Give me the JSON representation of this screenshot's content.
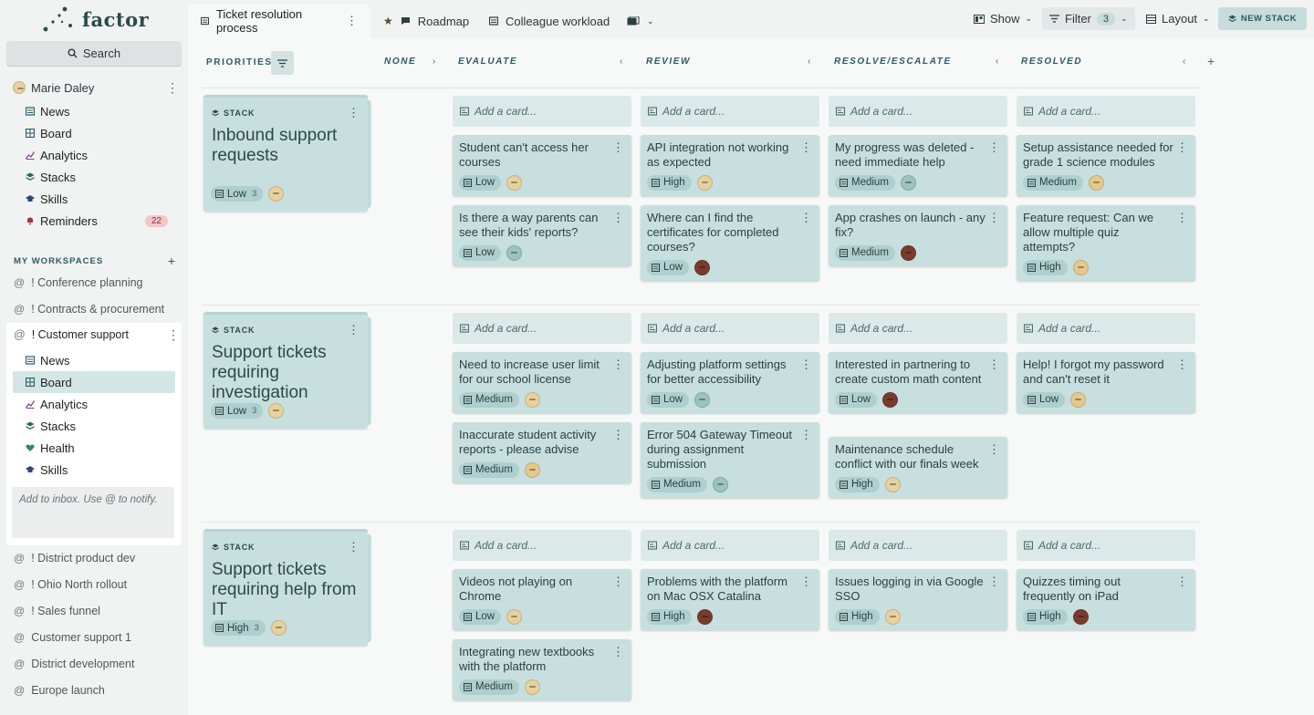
{
  "app": {
    "name": "factor"
  },
  "sidebar": {
    "search_label": "Search",
    "user": {
      "name": "Marie Daley"
    },
    "nav": [
      {
        "label": "News",
        "icon": "news-icon"
      },
      {
        "label": "Board",
        "icon": "board-icon"
      },
      {
        "label": "Analytics",
        "icon": "analytics-icon"
      },
      {
        "label": "Stacks",
        "icon": "stacks-icon"
      },
      {
        "label": "Skills",
        "icon": "skills-icon"
      },
      {
        "label": "Reminders",
        "icon": "bell-icon",
        "badge": "22"
      }
    ],
    "workspaces_label": "MY WORKSPACES",
    "workspaces_top": [
      "! Conference planning",
      "! Contracts & procurement"
    ],
    "active_workspace": {
      "name": "! Customer support",
      "items": [
        {
          "label": "News"
        },
        {
          "label": "Board"
        },
        {
          "label": "Analytics"
        },
        {
          "label": "Stacks"
        },
        {
          "label": "Health"
        },
        {
          "label": "Skills"
        }
      ],
      "inbox_placeholder": "Add to inbox. Use @ to notify."
    },
    "workspaces_bottom": [
      "! District product dev",
      "! Ohio North rollout",
      "! Sales funnel",
      "Customer support 1",
      "District development",
      "Europe launch"
    ]
  },
  "topbar": {
    "tabs": [
      {
        "label": "Ticket resolution process",
        "active": true
      },
      {
        "label": "Roadmap"
      },
      {
        "label": "Colleague workload"
      }
    ],
    "show_label": "Show",
    "filter_label": "Filter",
    "filter_count": "3",
    "layout_label": "Layout",
    "new_stack_label": "NEW STACK"
  },
  "board": {
    "priorities_label": "PRIORITIES",
    "columns": [
      "NONE",
      "EVALUATE",
      "REVIEW",
      "RESOLVE/ESCALATE",
      "RESOLVED"
    ],
    "add_card_label": "Add a card...",
    "stack_kind_label": "STACK",
    "rows": [
      {
        "stack": {
          "title": "Inbound support requests",
          "priority": "Low",
          "count": "3"
        },
        "cells": [
          [
            {
              "title": "Student can't access her courses",
              "priority": "Low",
              "avatar": "a1"
            },
            {
              "title": "Is there a way parents can see their kids' reports?",
              "priority": "Low",
              "avatar": "a3"
            }
          ],
          [
            {
              "title": "API integration not working as expected",
              "priority": "High",
              "avatar": "a1"
            },
            {
              "title": "Where can I find the certificates for completed courses?",
              "priority": "Low",
              "avatar": "a4"
            }
          ],
          [
            {
              "title": "My progress was deleted - need immediate help",
              "priority": "Medium",
              "avatar": "a3"
            },
            {
              "title": "App crashes on launch - any fix?",
              "priority": "Medium",
              "avatar": "a4"
            }
          ],
          [
            {
              "title": "Setup assistance needed for grade 1 science modules",
              "priority": "Medium",
              "avatar": "a2"
            },
            {
              "title": "Feature request: Can we allow multiple quiz attempts?",
              "priority": "High",
              "avatar": "a2"
            }
          ]
        ]
      },
      {
        "stack": {
          "title": "Support tickets requiring investigation",
          "priority": "Low",
          "count": "3"
        },
        "cells": [
          [
            {
              "title": "Need to increase user limit for our school license",
              "priority": "Medium",
              "avatar": "a1"
            },
            {
              "title": "Inaccurate student activity reports - please advise",
              "priority": "Medium",
              "avatar": "a2"
            }
          ],
          [
            {
              "title": "Adjusting platform settings for better accessibility",
              "priority": "Low",
              "avatar": "a3"
            },
            {
              "title": "Error 504 Gateway Timeout during assignment submission",
              "priority": "Medium",
              "avatar": "a3"
            }
          ],
          [
            {
              "title": "Interested in partnering to create custom math content",
              "priority": "Low",
              "avatar": "a4"
            },
            {
              "title": "Maintenance schedule conflict with our finals week",
              "priority": "High",
              "avatar": "a1"
            }
          ],
          [
            {
              "title": "Help! I forgot my password and can't reset it",
              "priority": "Low",
              "avatar": "a2"
            }
          ]
        ]
      },
      {
        "stack": {
          "title": "Support tickets requiring help from IT",
          "priority": "High",
          "count": "3"
        },
        "cells": [
          [
            {
              "title": "Videos not playing on Chrome",
              "priority": "Low",
              "avatar": "a1"
            },
            {
              "title": "Integrating new textbooks with the platform",
              "priority": "Medium",
              "avatar": "a1"
            }
          ],
          [
            {
              "title": "Problems with the platform on Mac OSX Catalina",
              "priority": "High",
              "avatar": "a4"
            }
          ],
          [
            {
              "title": "Issues logging in via Google SSO",
              "priority": "High",
              "avatar": "a1"
            }
          ],
          [
            {
              "title": "Quizzes timing out frequently on iPad",
              "priority": "High",
              "avatar": "a4"
            }
          ]
        ]
      }
    ]
  },
  "colors": {
    "card": "#c7dfdf",
    "accent": "#2e5a68",
    "badge": "#f3c6ca"
  }
}
